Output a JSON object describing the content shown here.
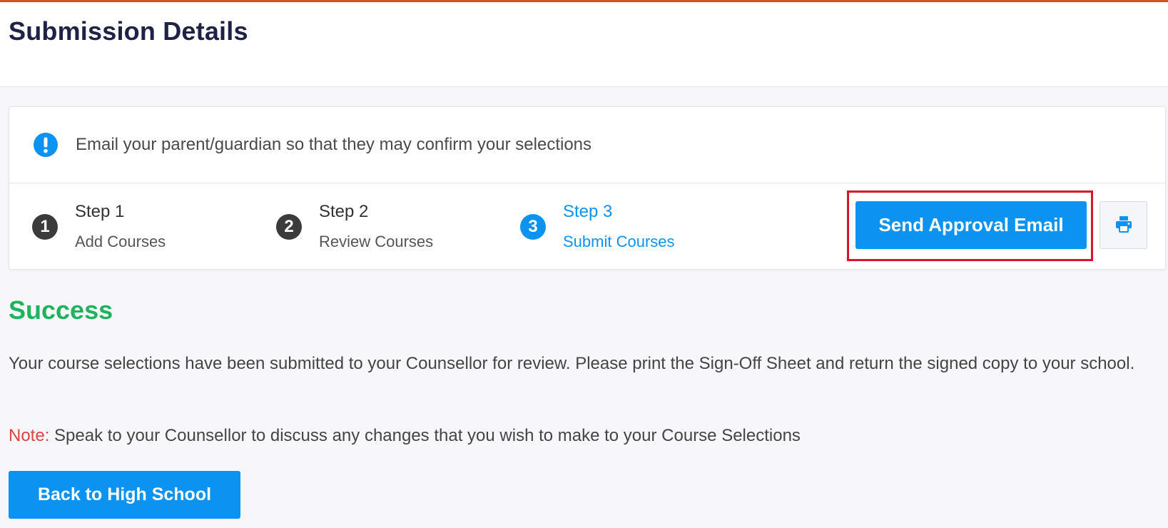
{
  "header": {
    "title": "Submission Details"
  },
  "alert": {
    "icon": "info-icon",
    "text": "Email your parent/guardian so that they may confirm your selections"
  },
  "steps": [
    {
      "number": "1",
      "title": "Step 1",
      "subtitle": "Add Courses",
      "active": false
    },
    {
      "number": "2",
      "title": "Step 2",
      "subtitle": "Review Courses",
      "active": false
    },
    {
      "number": "3",
      "title": "Step 3",
      "subtitle": "Submit Courses",
      "active": true
    }
  ],
  "actions": {
    "send_label": "Send Approval Email",
    "print_icon": "printer-icon"
  },
  "success": {
    "title": "Success",
    "message": "Your course selections have been submitted to your Counsellor for review. Please print the Sign-Off Sheet and return the signed copy to your school.",
    "note_label": "Note:",
    "note_text": " Speak to your Counsellor to discuss any changes that you wish to make to your Course Selections",
    "back_label": "Back to High School"
  },
  "colors": {
    "accent": "#0c93f2",
    "success": "#1fb35e",
    "note": "#e0433d",
    "title": "#1f2147",
    "highlight": "#d6142a",
    "top_bar": "#d0541c"
  }
}
